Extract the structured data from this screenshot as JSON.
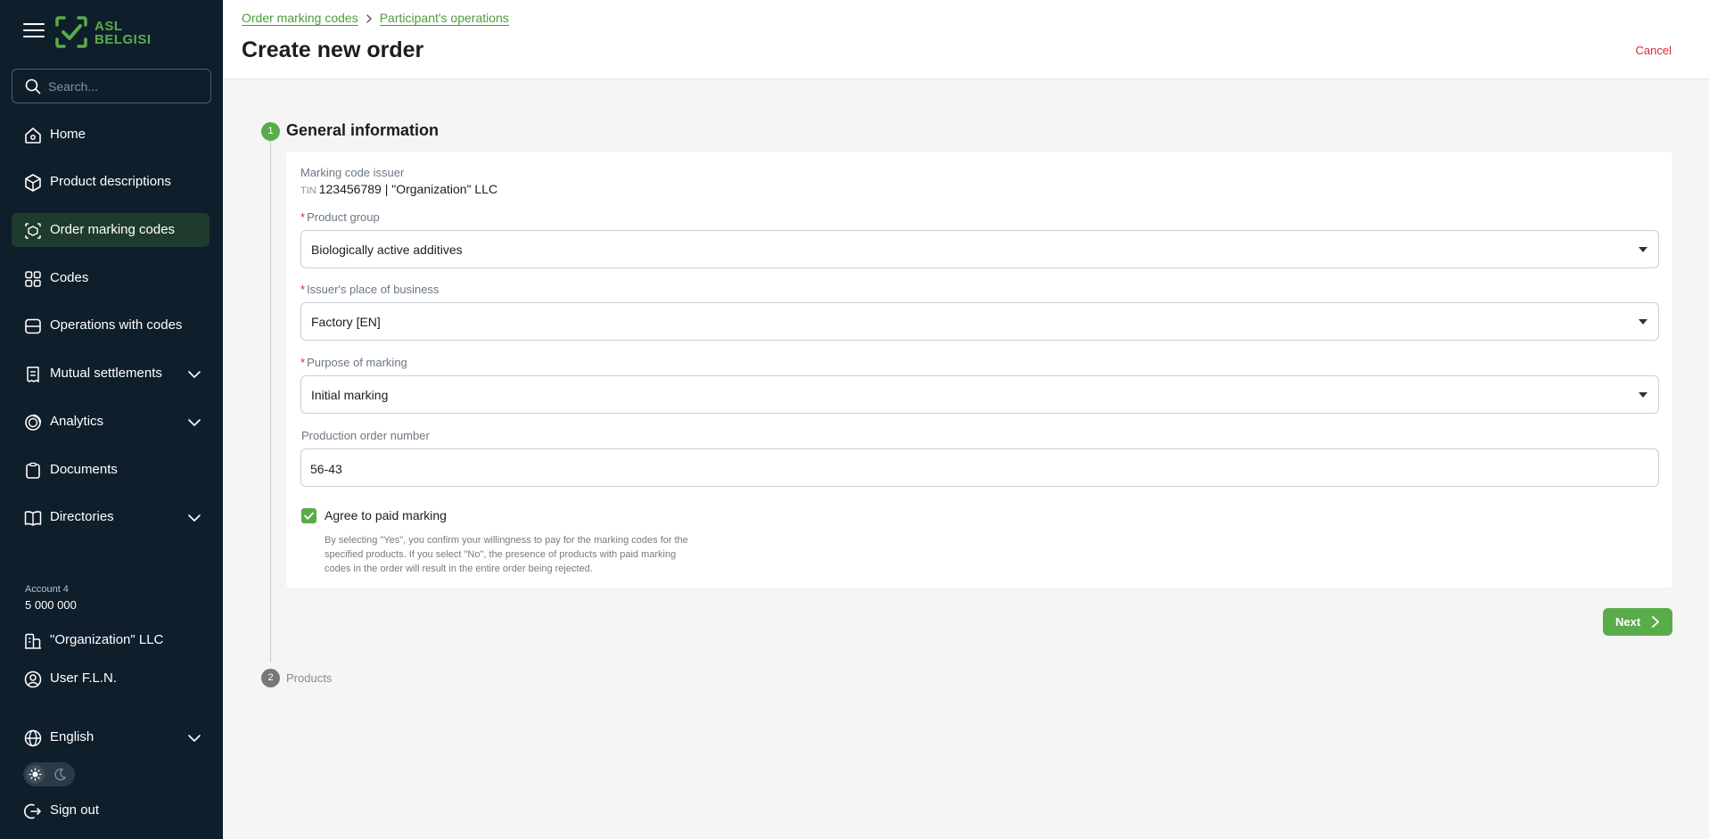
{
  "app": {
    "logo_text_line1": "ASL",
    "logo_text_line2": "BELGISI"
  },
  "search": {
    "placeholder": "Search..."
  },
  "sidebar": {
    "items": [
      {
        "label": "Home",
        "icon": "home-icon"
      },
      {
        "label": "Product descriptions",
        "icon": "box-icon"
      },
      {
        "label": "Order marking codes",
        "icon": "box-code-icon",
        "active": true
      },
      {
        "label": "Codes",
        "icon": "qr-code-icon"
      },
      {
        "label": "Operations with codes",
        "icon": "server-icon"
      },
      {
        "label": "Mutual settlements",
        "icon": "receipt-icon",
        "expandable": true
      },
      {
        "label": "Analytics",
        "icon": "chart-icon",
        "expandable": true
      },
      {
        "label": "Documents",
        "icon": "clipboard-icon"
      },
      {
        "label": "Directories",
        "icon": "book-icon",
        "expandable": true
      }
    ],
    "account": {
      "label": "Account 4",
      "balance": "5 000 000"
    },
    "organization": "\"Organization\" LLC",
    "user": "User F.L.N.",
    "language": "English",
    "sign_out": "Sign out"
  },
  "header": {
    "breadcrumb": [
      "Order marking codes",
      "Participant's operations"
    ],
    "title": "Create new order",
    "cancel_label": "Cancel"
  },
  "steps": [
    {
      "number": "1",
      "title": "General information"
    },
    {
      "number": "2",
      "title": "Products"
    }
  ],
  "form": {
    "issuer": {
      "label": "Marking code issuer",
      "tin_label": "TIN",
      "value": "123456789 | \"Organization\" LLC"
    },
    "product_group": {
      "label": "Product group",
      "value": "Biologically active additives"
    },
    "place_of_business": {
      "label": "Issuer's place of business",
      "value": "Factory [EN]"
    },
    "purpose": {
      "label": "Purpose of marking",
      "value": "Initial marking"
    },
    "production_order": {
      "label": "Production order number",
      "value": "56-43"
    },
    "paid_marking": {
      "label": "Agree to paid marking",
      "checked": true,
      "hint": "By selecting \"Yes\", you confirm your willingness to pay for the marking codes for the specified products. If you select \"No\", the presence of products with paid marking codes in the order will result in the entire order being rejected."
    },
    "next_label": "Next"
  },
  "colors": {
    "sidebar_bg": "#0f1e2b",
    "accent": "#5aac4a",
    "danger": "#d7263d"
  }
}
